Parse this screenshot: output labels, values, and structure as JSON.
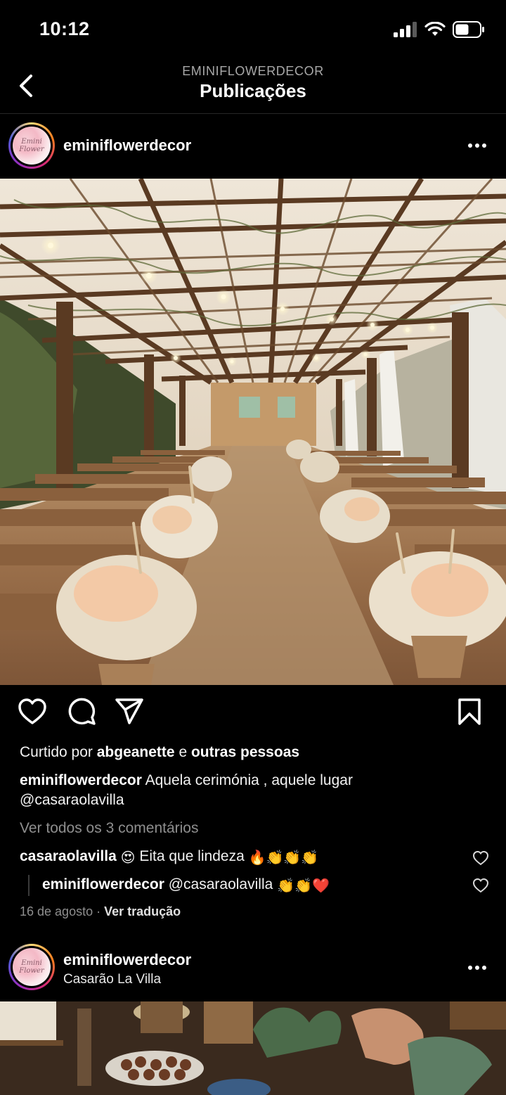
{
  "status_bar": {
    "time": "10:12"
  },
  "header": {
    "account": "EMINIFLOWERDECOR",
    "title": "Publicações"
  },
  "post1": {
    "username": "eminiflowerdecor",
    "avatar_text": "Emini Flower",
    "liked_prefix": "Curtido por",
    "liked_user": "abgeanette",
    "liked_joiner": "e",
    "liked_others": "outras pessoas",
    "caption_user": "eminiflowerdecor",
    "caption_text": "Aquela cerimónia , aquele lugar",
    "caption_mention": "@casaraolavilla",
    "view_comments": "Ver todos os 3 comentários",
    "comments": [
      {
        "user": "casaraolavilla",
        "text": "Eita que lindeza",
        "emoji_before": "😍",
        "emoji_after": "🔥👏👏👏"
      },
      {
        "user": "eminiflowerdecor",
        "text": "@casaraolavilla",
        "emoji_after": "👏👏❤️"
      }
    ],
    "date": "16 de agosto",
    "separator": "·",
    "translate": "Ver tradução"
  },
  "post2": {
    "username": "eminiflowerdecor",
    "location": "Casarão La Villa",
    "avatar_text": "Emini Flower"
  },
  "icons": {
    "back": "chevron-left-icon",
    "more": "more-horizontal-icon",
    "like": "heart-outline-icon",
    "comment": "comment-bubble-icon",
    "share": "paper-plane-icon",
    "save": "bookmark-outline-icon"
  },
  "colors": {
    "background": "#000000",
    "text": "#f5f5f5",
    "muted": "#8e8e8e"
  }
}
